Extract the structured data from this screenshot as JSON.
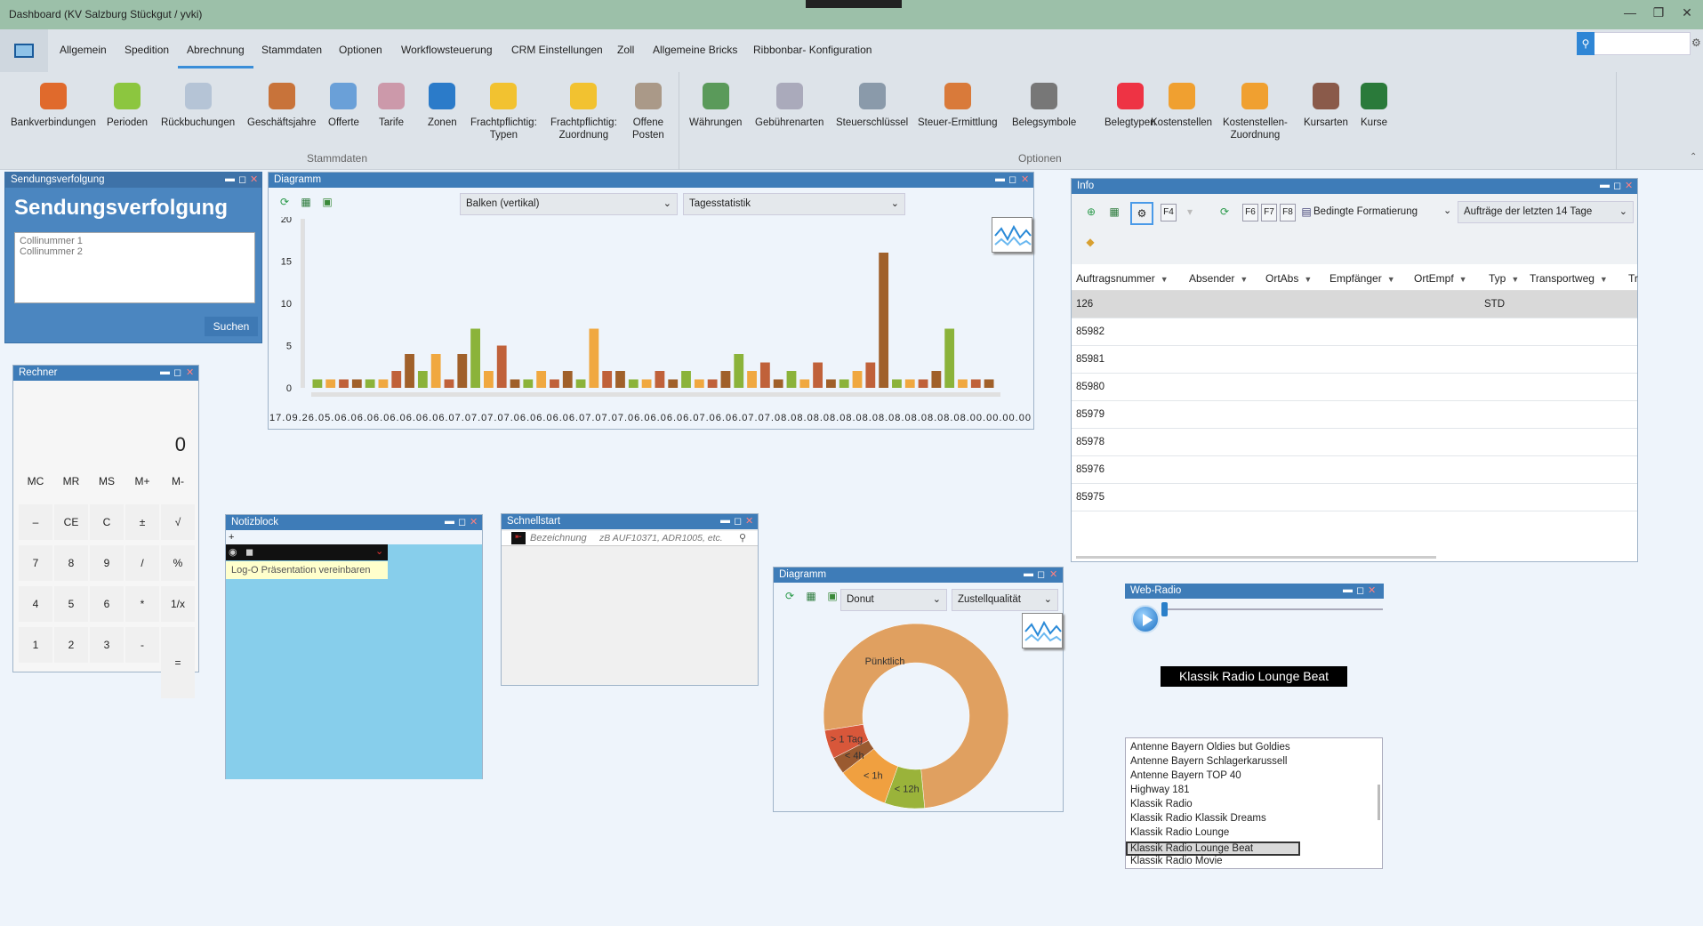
{
  "window": {
    "title": "Dashboard (KV Salzburg Stückgut / yvki)",
    "minimize": "—",
    "restore": "❐",
    "close": "✕"
  },
  "menu": {
    "items": [
      "Allgemein",
      "Spedition",
      "Abrechnung",
      "Stammdaten",
      "Optionen",
      "Workflowsteuerung",
      "CRM Einstellungen",
      "Zoll",
      "Allgemeine Bricks",
      "Ribbonbar- Konfiguration"
    ],
    "active": "Abrechnung"
  },
  "ribbon": {
    "stammdaten": [
      {
        "label": "Bankverbindungen",
        "color": "#e06a2c"
      },
      {
        "label": "Perioden",
        "color": "#8cc63f"
      },
      {
        "label": "Rückbuchungen",
        "color": "#b5c4d6"
      },
      {
        "label": "Geschäftsjahre",
        "color": "#c8733a"
      },
      {
        "label": "Offerte",
        "color": "#6aa0d8"
      },
      {
        "label": "Tarife",
        "color": "#c9a"
      },
      {
        "label": "Zonen",
        "color": "#2b7bc9"
      },
      {
        "label": "Frachtpflichtig:\nTypen",
        "color": "#f2c230"
      },
      {
        "label": "Frachtpflichtig:\nZuordnung",
        "color": "#f2c230"
      },
      {
        "label": "Offene\nPosten",
        "color": "#a98"
      }
    ],
    "optionen": [
      {
        "label": "Währungen",
        "color": "#5a9a5a"
      },
      {
        "label": "Gebührenarten",
        "color": "#aab"
      },
      {
        "label": "Steuerschlüssel",
        "color": "#8a9aaa"
      },
      {
        "label": "Steuer-Ermittlung",
        "color": "#d97a3a"
      },
      {
        "label": "Belegsymbole",
        "color": "#777"
      },
      {
        "label": "Belegtypen",
        "color": "#e34"
      },
      {
        "label": "Kostenstellen",
        "color": "#f0a030"
      },
      {
        "label": "Kostenstellen-\nZuordnung",
        "color": "#f0a030"
      },
      {
        "label": "Kursarten",
        "color": "#8a5a4a"
      },
      {
        "label": "Kurse",
        "color": "#2a7a3a"
      }
    ],
    "group_stammdaten": "Stammdaten",
    "group_optionen": "Optionen"
  },
  "sendungsverfolgung": {
    "title": "Sendungsverfolgung",
    "heading": "Sendungsverfolgung",
    "placeholder": "Collinummer 1\nCollinummer 2",
    "button": "Suchen"
  },
  "rechner": {
    "title": "Rechner",
    "display": "0",
    "keys": [
      [
        "MC",
        "MR",
        "MS",
        "M+",
        "M-"
      ],
      [
        "–",
        "CE",
        "C",
        "±",
        "√"
      ],
      [
        "7",
        "8",
        "9",
        "/",
        "%"
      ],
      [
        "4",
        "5",
        "6",
        "*",
        "1/x"
      ],
      [
        "1",
        "2",
        "3",
        "-",
        "="
      ]
    ]
  },
  "notizblock": {
    "title": "Notizblock",
    "plus": "+",
    "item": "Log-O Präsentation vereinbaren"
  },
  "schnellstart": {
    "title": "Schnellstart",
    "col": "Bezeichnung",
    "placeholder": "zB AUF10371, ADR1005, etc."
  },
  "diagramm1": {
    "title": "Diagramm",
    "type_select": "Balken (vertikal)",
    "stat_select": "Tagesstatistik",
    "xtick_text": "17.09.26.05.06.06.06.06.06.06.06.07.07.07.07.06.06.06.06.07.07.07.06.06.06.06.07.06.06.07.07.08.08.08.08.08.08.08.08.08.08.08.08.00.00.00.00"
  },
  "chart_data": [
    {
      "type": "bar",
      "title": "",
      "xlabel": "",
      "ylabel": "",
      "ylim": [
        0,
        20
      ],
      "yticks": [
        0,
        5,
        10,
        15,
        20
      ],
      "values": [
        1,
        1,
        1,
        1,
        1,
        1,
        2,
        4,
        2,
        4,
        1,
        4,
        7,
        2,
        5,
        1,
        1,
        2,
        1,
        2,
        1,
        7,
        2,
        2,
        1,
        1,
        2,
        1,
        2,
        1,
        1,
        2,
        4,
        2,
        3,
        1,
        2,
        1,
        3,
        1,
        1,
        2,
        3,
        16,
        1,
        1,
        1,
        2,
        7,
        1,
        1,
        1
      ],
      "colors": [
        "#8bb33a",
        "#f0a840",
        "#c0613a",
        "#a0602a"
      ]
    },
    {
      "type": "pie",
      "donut": true,
      "title": "",
      "slices": [
        {
          "name": "Pünktlich",
          "value": 76,
          "color": "#e0a060"
        },
        {
          "name": "< 12h",
          "value": 7,
          "color": "#9ab33a"
        },
        {
          "name": "< 1h",
          "value": 9,
          "color": "#f0a040"
        },
        {
          "name": "< 4h",
          "value": 3,
          "color": "#9a5a30"
        },
        {
          "name": "> 1 Tag",
          "value": 5,
          "color": "#d8573a"
        }
      ]
    }
  ],
  "diagramm2": {
    "title": "Diagramm",
    "type_select": "Donut",
    "stat_select": "Zustellqualität"
  },
  "info": {
    "title": "Info",
    "f_keys": [
      "F4",
      "F6",
      "F7",
      "F8"
    ],
    "cond_format": "Bedingte Formatierung",
    "filter": "Aufträge der letzten 14 Tage",
    "columns": [
      "Auftragsnummer",
      "Absender",
      "OrtAbs",
      "Empfänger",
      "OrtEmpf",
      "Typ",
      "Transportweg",
      "Tr"
    ],
    "rows": [
      [
        "126",
        "STD"
      ],
      [
        "85982",
        ""
      ],
      [
        "85981",
        ""
      ],
      [
        "85980",
        ""
      ],
      [
        "85979",
        ""
      ],
      [
        "85978",
        ""
      ],
      [
        "85976",
        ""
      ],
      [
        "85975",
        ""
      ]
    ]
  },
  "webradio": {
    "title": "Web-Radio",
    "now_playing": "Klassik Radio Lounge Beat",
    "stations": [
      "Antenne Bayern Oldies but Goldies",
      "Antenne Bayern Schlagerkarussell",
      "Antenne Bayern TOP 40",
      "Highway 181",
      "Klassik Radio",
      "Klassik Radio Klassik Dreams",
      "Klassik Radio Lounge",
      "Klassik Radio Lounge Beat",
      "Klassik Radio Movie"
    ],
    "selected_index": 7
  }
}
